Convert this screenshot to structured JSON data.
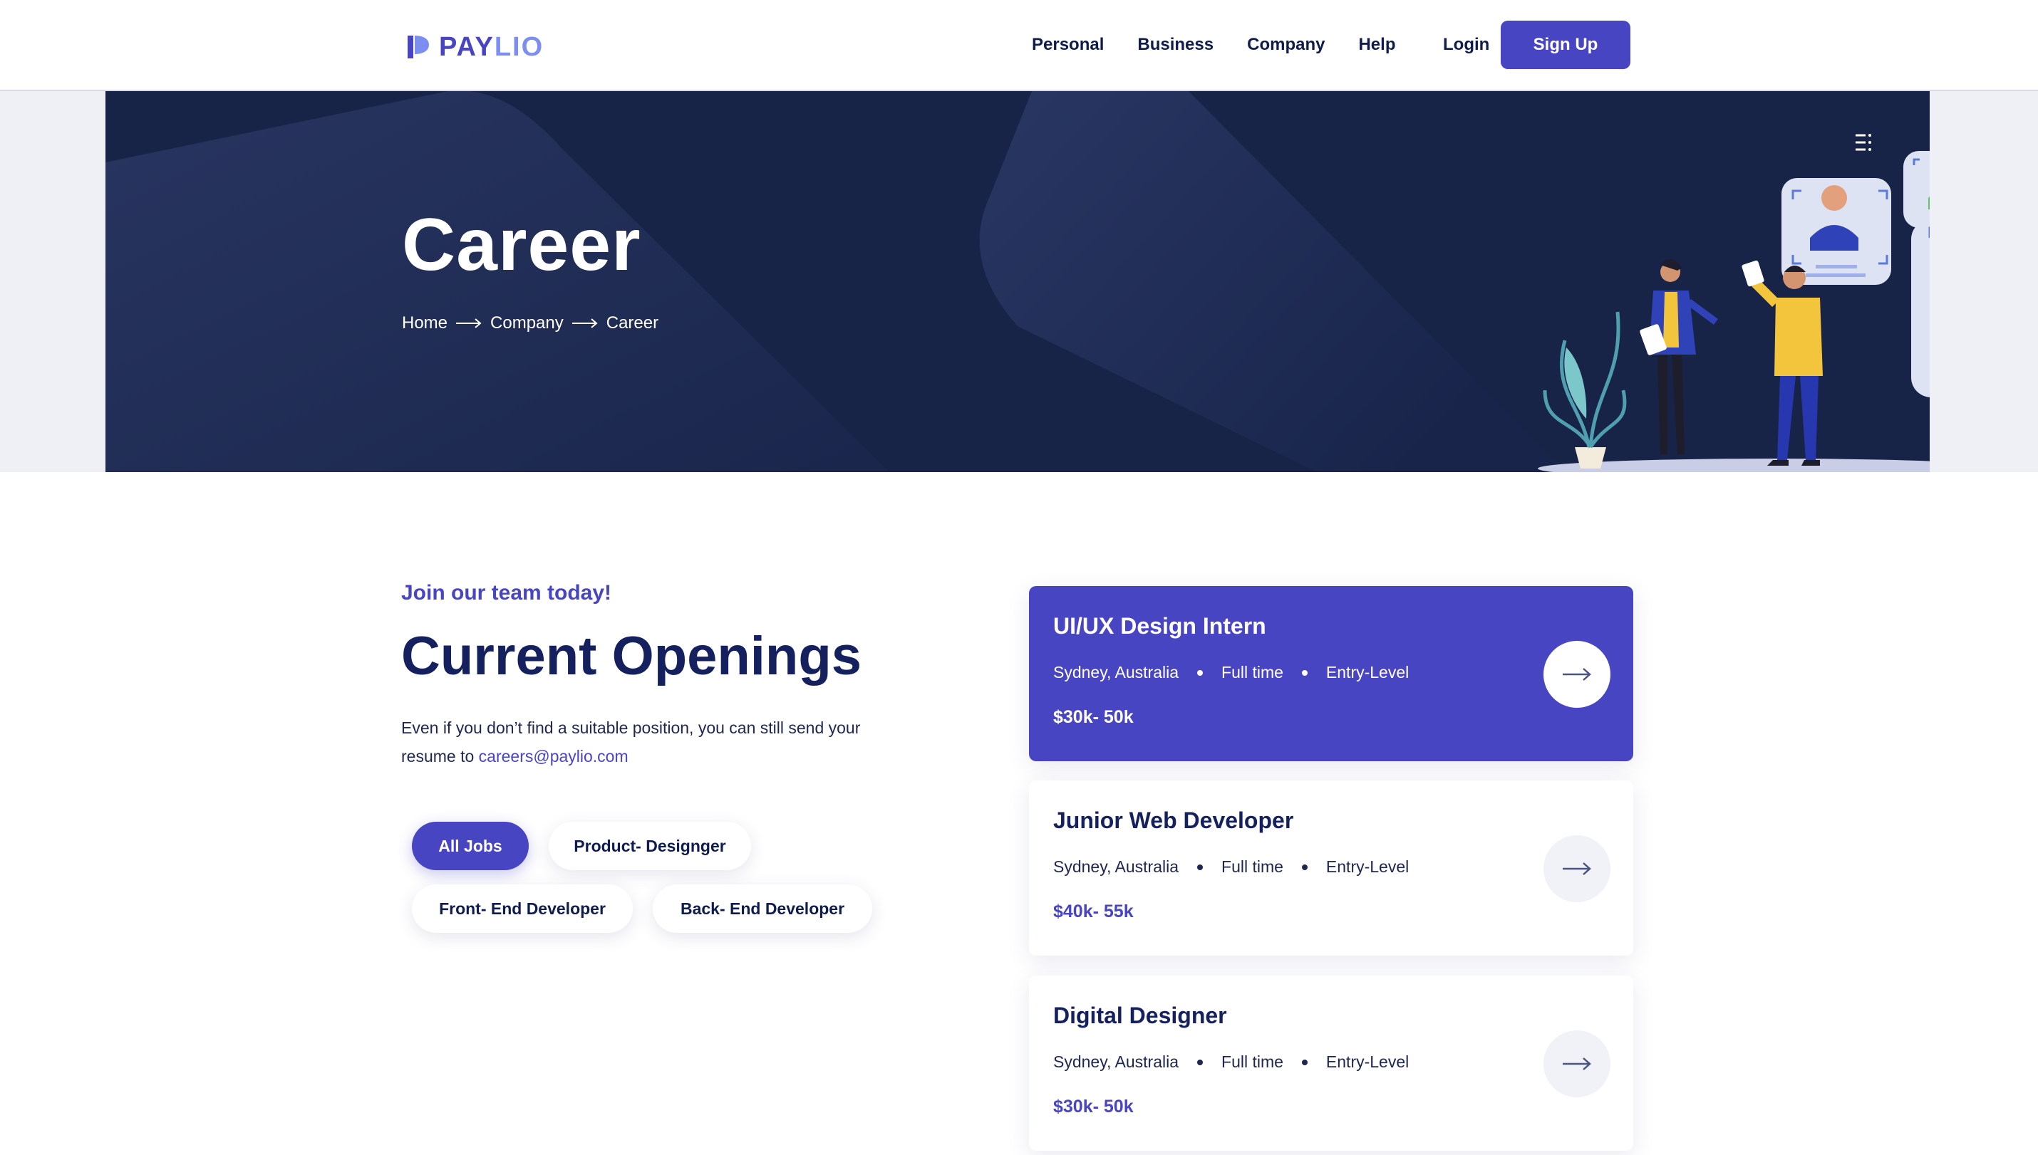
{
  "brand": {
    "name_part1": "PAY",
    "name_part2": "LIO",
    "primary_color": "#4845c3",
    "dark_color": "#172347"
  },
  "nav": {
    "items": [
      "Personal",
      "Business",
      "Company",
      "Help"
    ],
    "login": "Login",
    "signup": "Sign Up"
  },
  "hero": {
    "title": "Career",
    "breadcrumb": [
      "Home",
      "Company",
      "Career"
    ]
  },
  "openings": {
    "eyebrow": "Join our team today!",
    "title": "Current Openings",
    "intro": "Even if you don’t find a suitable position, you can still send your resume to",
    "email": "careers@paylio.com",
    "filters": [
      "All Jobs",
      "Product- Designger",
      "Front- End Developer",
      "Back- End Developer"
    ],
    "active_filter": "All Jobs"
  },
  "jobs": [
    {
      "title": "UI/UX Design Intern",
      "location": "Sydney, Australia",
      "type": "Full time",
      "level": "Entry-Level",
      "salary": "$30k- 50k",
      "featured": true
    },
    {
      "title": "Junior Web Developer",
      "location": "Sydney, Australia",
      "type": "Full time",
      "level": "Entry-Level",
      "salary": "$40k- 55k",
      "featured": false
    },
    {
      "title": "Digital Designer",
      "location": "Sydney, Australia",
      "type": "Full time",
      "level": "Entry-Level",
      "salary": "$30k- 50k",
      "featured": false
    }
  ]
}
